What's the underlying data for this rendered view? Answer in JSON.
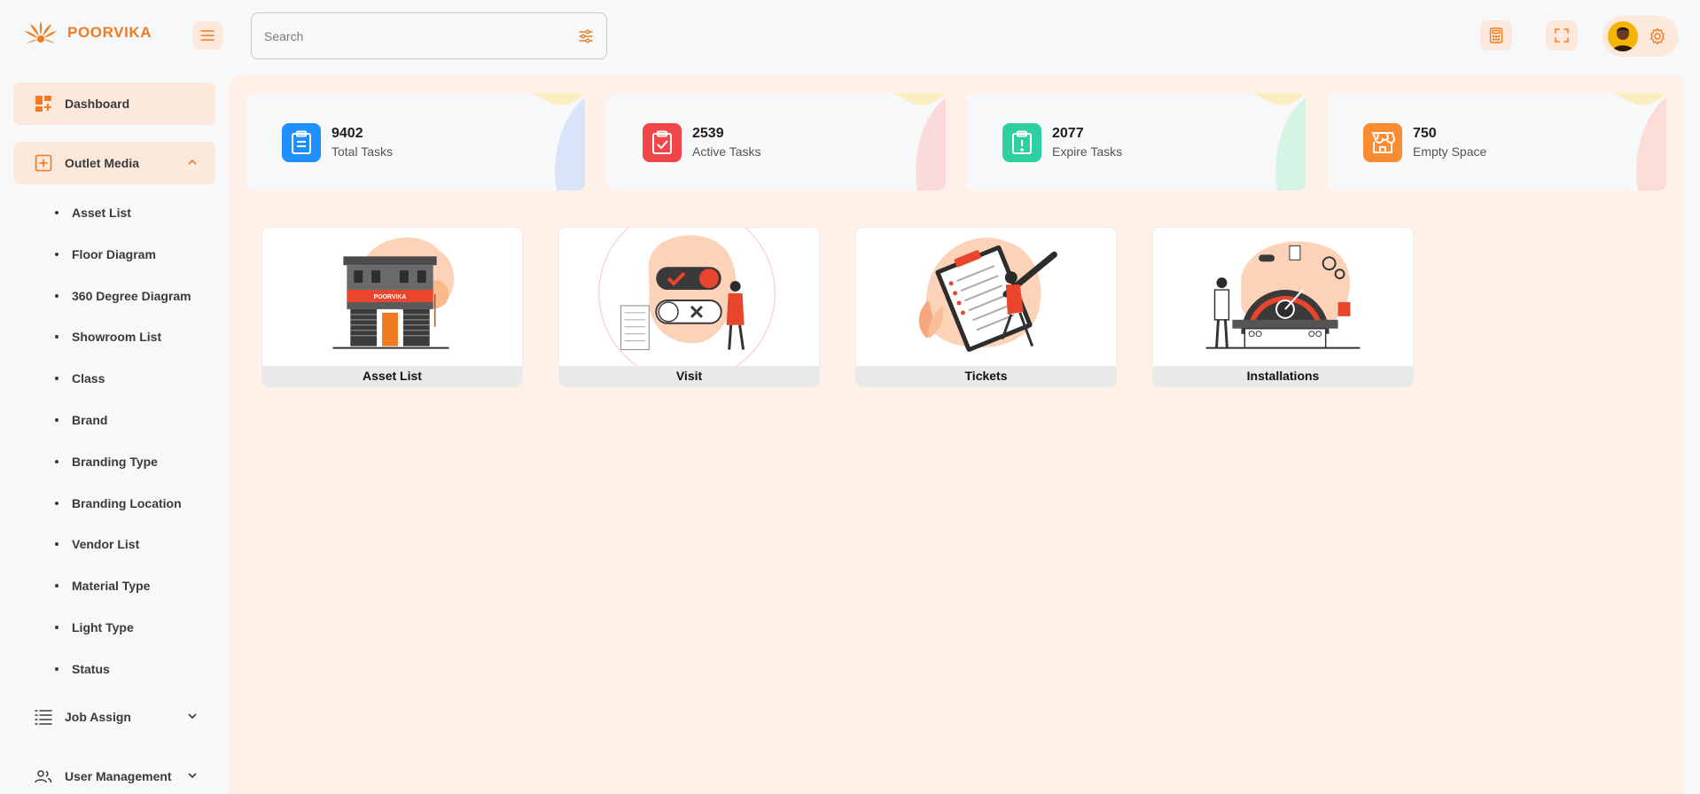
{
  "app": {
    "brand": "POORVIKA"
  },
  "search": {
    "placeholder": "Search"
  },
  "colors": {
    "accent": "#f07b20",
    "accent_soft": "#fde8dc",
    "main_bg": "#fff1e8"
  },
  "sidebar": {
    "items": [
      {
        "label": "Dashboard",
        "icon": "dashboard-icon"
      },
      {
        "label": "Outlet Media",
        "icon": "add-box-icon",
        "expanded": true
      },
      {
        "label": "Job Assign",
        "icon": "list-icon"
      },
      {
        "label": "User Management",
        "icon": "users-icon"
      }
    ],
    "sub_items": [
      "Asset List",
      "Floor Diagram",
      "360 Degree Diagram",
      "Showroom List",
      "Class",
      "Brand",
      "Branding Type",
      "Branding Location",
      "Vendor List",
      "Material Type",
      "Light Type",
      "Status"
    ]
  },
  "stats": [
    {
      "value": "9402",
      "label": "Total Tasks",
      "icon": "clipboard-icon",
      "color": "#1e90ff"
    },
    {
      "value": "2539",
      "label": "Active Tasks",
      "icon": "clipboard-check-icon",
      "color": "#f0474b"
    },
    {
      "value": "2077",
      "label": "Expire Tasks",
      "icon": "alert-icon",
      "color": "#2ecfa1"
    },
    {
      "value": "750",
      "label": "Empty Space",
      "icon": "store-icon",
      "color": "#fb8c32"
    }
  ],
  "tiles": [
    {
      "label": "Asset List"
    },
    {
      "label": "Visit"
    },
    {
      "label": "Tickets"
    },
    {
      "label": "Installations"
    }
  ]
}
